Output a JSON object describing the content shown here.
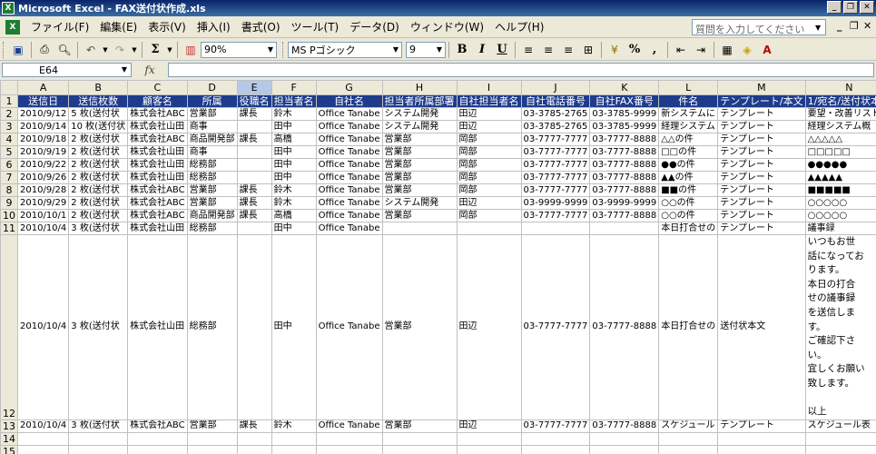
{
  "window": {
    "title": "Microsoft Excel - FAX送付状作成.xls"
  },
  "menu": {
    "items": [
      "ファイル(F)",
      "編集(E)",
      "表示(V)",
      "挿入(I)",
      "書式(O)",
      "ツール(T)",
      "データ(D)",
      "ウィンドウ(W)",
      "ヘルプ(H)"
    ],
    "help_placeholder": "質問を入力してください"
  },
  "toolbar": {
    "zoom": "90%",
    "font_name": "MS Pゴシック",
    "font_size": "9",
    "sigma": "Σ",
    "percent": "%",
    "bold": "B",
    "italic": "I",
    "underline": "U",
    "comma": ","
  },
  "formula_bar": {
    "cell_ref": "E64",
    "fx": "fx",
    "value": ""
  },
  "sheet": {
    "columns": [
      "A",
      "B",
      "C",
      "D",
      "E",
      "F",
      "G",
      "H",
      "I",
      "J",
      "K",
      "L",
      "M",
      "N"
    ],
    "selected_column": "E",
    "row_numbers": [
      "1",
      "2",
      "3",
      "4",
      "5",
      "6",
      "7",
      "8",
      "9",
      "10",
      "11",
      "12",
      "13",
      "14",
      "15",
      "16"
    ],
    "header": [
      "送信日",
      "送信枚数",
      "顧客名",
      "所属",
      "役職名",
      "担当者名",
      "自社名",
      "担当者所属部署",
      "自社担当者名",
      "自社電話番号",
      "自社FAX番号",
      "件名",
      "テンプレート/本文",
      "1/宛名/送付状本文"
    ],
    "rows": [
      [
        "2010/9/12",
        "5 枚(送付状",
        "株式会社ABC",
        "営業部",
        "課長",
        "鈴木",
        "Office Tanabe",
        "システム開発",
        "田辺",
        "03-3785-2765",
        "03-3785-9999",
        "新システムに",
        "テンプレート",
        "要望・改善リスト"
      ],
      [
        "2010/9/14",
        "10 枚(送付状",
        "株式会社山田",
        "商事",
        "",
        "田中",
        "Office Tanabe",
        "システム開発",
        "田辺",
        "03-3785-2765",
        "03-3785-9999",
        "経理システム",
        "テンプレート",
        "経理システム概"
      ],
      [
        "2010/9/18",
        "2 枚(送付状",
        "株式会社ABC",
        "商品開発部",
        "課長",
        "高橋",
        "Office Tanabe",
        "営業部",
        "岡部",
        "03-7777-7777",
        "03-7777-8888",
        "△△の件",
        "テンプレート",
        "△△△△△"
      ],
      [
        "2010/9/19",
        "2 枚(送付状",
        "株式会社山田",
        "商事",
        "",
        "田中",
        "Office Tanabe",
        "営業部",
        "岡部",
        "03-7777-7777",
        "03-7777-8888",
        "□□の件",
        "テンプレート",
        "□□□□□"
      ],
      [
        "2010/9/22",
        "2 枚(送付状",
        "株式会社山田",
        "総務部",
        "",
        "田中",
        "Office Tanabe",
        "営業部",
        "岡部",
        "03-7777-7777",
        "03-7777-8888",
        "●●の件",
        "テンプレート",
        "●●●●●"
      ],
      [
        "2010/9/26",
        "2 枚(送付状",
        "株式会社山田",
        "総務部",
        "",
        "田中",
        "Office Tanabe",
        "営業部",
        "岡部",
        "03-7777-7777",
        "03-7777-8888",
        "▲▲の件",
        "テンプレート",
        "▲▲▲▲▲"
      ],
      [
        "2010/9/28",
        "2 枚(送付状",
        "株式会社ABC",
        "営業部",
        "課長",
        "鈴木",
        "Office Tanabe",
        "営業部",
        "岡部",
        "03-7777-7777",
        "03-7777-8888",
        "■■の件",
        "テンプレート",
        "■■■■■"
      ],
      [
        "2010/9/29",
        "2 枚(送付状",
        "株式会社ABC",
        "営業部",
        "課長",
        "鈴木",
        "Office Tanabe",
        "システム開発",
        "田辺",
        "03-9999-9999",
        "03-9999-9999",
        "○○の件",
        "テンプレート",
        "○○○○○"
      ],
      [
        "2010/10/1",
        "2 枚(送付状",
        "株式会社ABC",
        "商品開発部",
        "課長",
        "高橋",
        "Office Tanabe",
        "営業部",
        "岡部",
        "03-7777-7777",
        "03-7777-8888",
        "○○の件",
        "テンプレート",
        "○○○○○"
      ],
      [
        "2010/10/4",
        "3 枚(送付状",
        "株式会社山田",
        "総務部",
        "",
        "田中",
        "Office Tanabe",
        "",
        "",
        "",
        "",
        "本日打合せの",
        "テンプレート",
        "議事録"
      ],
      [
        "2010/10/4",
        "3 枚(送付状",
        "株式会社山田",
        "総務部",
        "",
        "田中",
        "Office Tanabe",
        "営業部",
        "田辺",
        "03-7777-7777",
        "03-7777-8888",
        "本日打合せの",
        "送付状本文",
        "いつもお世\n話になってお\nります。\n本日の打合\nせの議事録\nを送信しま\nす。\nご確認下さ\nい。\n宜しくお願い\n致します。\n\n以上"
      ],
      [
        "2010/10/4",
        "3 枚(送付状",
        "株式会社ABC",
        "営業部",
        "課長",
        "鈴木",
        "Office Tanabe",
        "営業部",
        "田辺",
        "03-7777-7777",
        "03-7777-8888",
        "スケジュール",
        "テンプレート",
        "スケジュール表"
      ],
      [
        "",
        "",
        "",
        "",
        "",
        "",
        "",
        "",
        "",
        "",
        "",
        "",
        "",
        ""
      ],
      [
        "",
        "",
        "",
        "",
        "",
        "",
        "",
        "",
        "",
        "",
        "",
        "",
        "",
        ""
      ],
      [
        "",
        "",
        "",
        "",
        "",
        "",
        "",
        "",
        "",
        "",
        "",
        "",
        "",
        ""
      ]
    ]
  }
}
